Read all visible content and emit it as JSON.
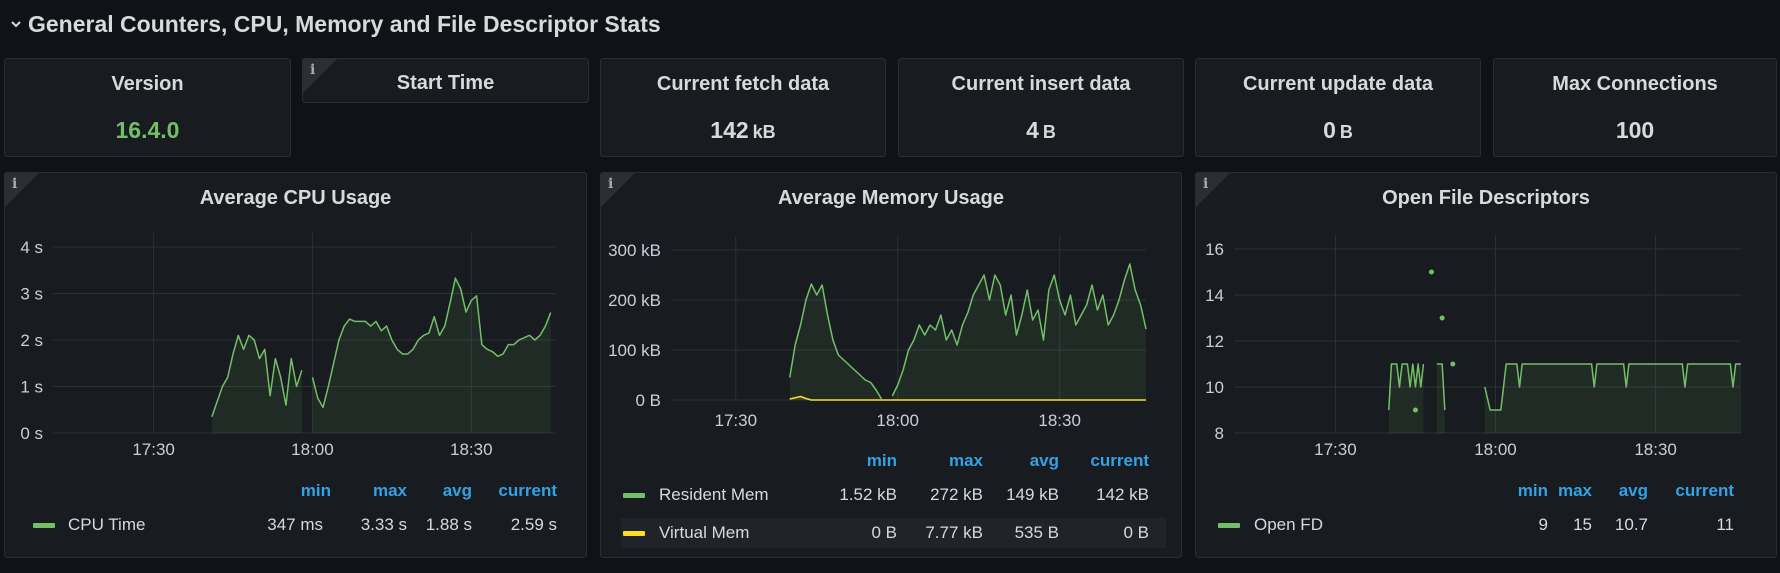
{
  "row": {
    "title": "General Counters, CPU, Memory and File Descriptor Stats"
  },
  "stats": [
    {
      "title": "Version",
      "value": "16.4.0",
      "unit": "",
      "info": false
    },
    {
      "title": "Start Time",
      "value": "",
      "unit": "",
      "info": true
    },
    {
      "title": "Current fetch data",
      "value": "142",
      "unit": "kB",
      "info": false
    },
    {
      "title": "Current insert data",
      "value": "4",
      "unit": "B",
      "info": false
    },
    {
      "title": "Current update data",
      "value": "0",
      "unit": "B",
      "info": false
    },
    {
      "title": "Max Connections",
      "value": "100",
      "unit": "",
      "info": false
    }
  ],
  "colors": {
    "green": "#73bf69",
    "yellow": "#fade2a",
    "blue": "#33a2e5"
  },
  "info_icon": "info-icon",
  "legend_headers": [
    "min",
    "max",
    "avg",
    "current"
  ],
  "graphs": [
    {
      "id": "cpu",
      "title": "Average CPU Usage",
      "legend": [
        {
          "name": "CPU Time",
          "color": "#73bf69",
          "min": "347 ms",
          "max": "3.33 s",
          "avg": "1.88 s",
          "current": "2.59 s"
        }
      ],
      "chart_data": {
        "type": "line",
        "title": "Average CPU Usage",
        "x_ticks": [
          "17:30",
          "18:00",
          "18:30"
        ],
        "y_ticks": [
          "0 s",
          "1 s",
          "2 s",
          "3 s",
          "4 s"
        ],
        "ylim": [
          0,
          4
        ],
        "grid": true,
        "series": [
          {
            "name": "CPU Time",
            "color": "#73bf69",
            "segments": [
              [
                [
                  "17:41",
                  0.35
                ],
                [
                  "17:43",
                  1.0
                ],
                [
                  "17:44",
                  1.2
                ],
                [
                  "17:45",
                  1.7
                ],
                [
                  "17:46",
                  2.1
                ],
                [
                  "17:47",
                  1.8
                ],
                [
                  "17:48",
                  2.1
                ],
                [
                  "17:49",
                  2.0
                ],
                [
                  "17:50",
                  1.6
                ],
                [
                  "17:51",
                  1.8
                ],
                [
                  "17:52",
                  0.8
                ],
                [
                  "17:53",
                  1.6
                ],
                [
                  "17:54",
                  1.2
                ],
                [
                  "17:55",
                  0.6
                ],
                [
                  "17:56",
                  1.6
                ],
                [
                  "17:57",
                  1.0
                ],
                [
                  "17:58",
                  1.35
                ]
              ],
              [
                [
                  "18:00",
                  1.2
                ],
                [
                  "18:01",
                  0.75
                ],
                [
                  "18:02",
                  0.55
                ],
                [
                  "18:03",
                  1.0
                ],
                [
                  "18:04",
                  1.5
                ],
                [
                  "18:05",
                  2.0
                ],
                [
                  "18:06",
                  2.3
                ],
                [
                  "18:07",
                  2.45
                ],
                [
                  "18:08",
                  2.4
                ],
                [
                  "18:10",
                  2.4
                ],
                [
                  "18:11",
                  2.3
                ],
                [
                  "18:12",
                  2.4
                ],
                [
                  "18:13",
                  2.2
                ],
                [
                  "18:14",
                  2.3
                ],
                [
                  "18:15",
                  2.0
                ],
                [
                  "18:16",
                  1.8
                ],
                [
                  "18:17",
                  1.7
                ],
                [
                  "18:18",
                  1.7
                ],
                [
                  "18:19",
                  1.8
                ],
                [
                  "18:20",
                  2.0
                ],
                [
                  "18:21",
                  2.1
                ],
                [
                  "18:22",
                  2.15
                ],
                [
                  "18:23",
                  2.5
                ],
                [
                  "18:24",
                  2.1
                ],
                [
                  "18:25",
                  2.3
                ],
                [
                  "18:26",
                  2.8
                ],
                [
                  "18:27",
                  3.33
                ],
                [
                  "18:28",
                  3.1
                ],
                [
                  "18:29",
                  2.6
                ],
                [
                  "18:30",
                  2.85
                ],
                [
                  "18:31",
                  2.95
                ],
                [
                  "18:32",
                  1.9
                ],
                [
                  "18:33",
                  1.8
                ],
                [
                  "18:34",
                  1.75
                ],
                [
                  "18:35",
                  1.65
                ],
                [
                  "18:36",
                  1.7
                ],
                [
                  "18:37",
                  1.9
                ],
                [
                  "18:38",
                  1.9
                ],
                [
                  "18:39",
                  2.0
                ],
                [
                  "18:40",
                  2.05
                ],
                [
                  "18:41",
                  2.1
                ],
                [
                  "18:42",
                  2.0
                ],
                [
                  "18:43",
                  2.1
                ],
                [
                  "18:44",
                  2.3
                ],
                [
                  "18:45",
                  2.59
                ]
              ]
            ]
          }
        ]
      }
    },
    {
      "id": "mem",
      "title": "Average Memory Usage",
      "legend": [
        {
          "name": "Resident Mem",
          "color": "#73bf69",
          "min": "1.52 kB",
          "max": "272 kB",
          "avg": "149 kB",
          "current": "142 kB"
        },
        {
          "name": "Virtual Mem",
          "color": "#fade2a",
          "min": "0 B",
          "max": "7.77 kB",
          "avg": "535 B",
          "current": "0 B"
        }
      ],
      "chart_data": {
        "type": "line",
        "title": "Average Memory Usage",
        "x_ticks": [
          "17:30",
          "18:00",
          "18:30"
        ],
        "y_ticks": [
          "0 B",
          "100 kB",
          "200 kB",
          "300 kB"
        ],
        "ylim": [
          0,
          300
        ],
        "grid": true,
        "series": [
          {
            "name": "Resident Mem",
            "color": "#73bf69",
            "segments": [
              [
                [
                  "17:40",
                  45
                ],
                [
                  "17:41",
                  110
                ],
                [
                  "17:42",
                  150
                ],
                [
                  "17:43",
                  200
                ],
                [
                  "17:44",
                  232
                ],
                [
                  "17:45",
                  210
                ],
                [
                  "17:46",
                  230
                ],
                [
                  "17:47",
                  170
                ],
                [
                  "17:48",
                  120
                ],
                [
                  "17:49",
                  90
                ],
                [
                  "17:50",
                  80
                ],
                [
                  "17:51",
                  70
                ],
                [
                  "17:52",
                  60
                ],
                [
                  "17:53",
                  50
                ],
                [
                  "17:54",
                  40
                ],
                [
                  "17:55",
                  35
                ],
                [
                  "17:56",
                  20
                ],
                [
                  "17:57",
                  2
                ]
              ],
              [
                [
                  "17:59",
                  8
                ],
                [
                  "18:00",
                  30
                ],
                [
                  "18:01",
                  60
                ],
                [
                  "18:02",
                  100
                ],
                [
                  "18:03",
                  120
                ],
                [
                  "18:04",
                  150
                ],
                [
                  "18:05",
                  130
                ],
                [
                  "18:06",
                  150
                ],
                [
                  "18:07",
                  140
                ],
                [
                  "18:08",
                  170
                ],
                [
                  "18:09",
                  120
                ],
                [
                  "18:10",
                  140
                ],
                [
                  "18:11",
                  110
                ],
                [
                  "18:12",
                  150
                ],
                [
                  "18:13",
                  175
                ],
                [
                  "18:14",
                  210
                ],
                [
                  "18:15",
                  230
                ],
                [
                  "18:16",
                  250
                ],
                [
                  "18:17",
                  200
                ],
                [
                  "18:18",
                  250
                ],
                [
                  "18:19",
                  230
                ],
                [
                  "18:20",
                  170
                ],
                [
                  "18:21",
                  210
                ],
                [
                  "18:22",
                  130
                ],
                [
                  "18:23",
                  170
                ],
                [
                  "18:24",
                  220
                ],
                [
                  "18:25",
                  160
                ],
                [
                  "18:26",
                  180
                ],
                [
                  "18:27",
                  120
                ],
                [
                  "18:28",
                  220
                ],
                [
                  "18:29",
                  250
                ],
                [
                  "18:30",
                  200
                ],
                [
                  "18:31",
                  170
                ],
                [
                  "18:32",
                  210
                ],
                [
                  "18:33",
                  150
                ],
                [
                  "18:34",
                  170
                ],
                [
                  "18:35",
                  190
                ],
                [
                  "18:36",
                  230
                ],
                [
                  "18:37",
                  180
                ],
                [
                  "18:38",
                  210
                ],
                [
                  "18:39",
                  150
                ],
                [
                  "18:40",
                  170
                ],
                [
                  "18:41",
                  200
                ],
                [
                  "18:42",
                  240
                ],
                [
                  "18:43",
                  272
                ],
                [
                  "18:44",
                  220
                ],
                [
                  "18:45",
                  190
                ],
                [
                  "18:46",
                  142
                ]
              ]
            ]
          },
          {
            "name": "Virtual Mem",
            "color": "#fade2a",
            "segments": [
              [
                [
                  "17:40",
                  2
                ],
                [
                  "17:42",
                  7
                ],
                [
                  "17:43",
                  3
                ],
                [
                  "17:44",
                  0
                ],
                [
                  "18:46",
                  0
                ]
              ]
            ]
          }
        ]
      }
    },
    {
      "id": "fd",
      "title": "Open File Descriptors",
      "legend": [
        {
          "name": "Open FD",
          "color": "#73bf69",
          "min": "9",
          "max": "15",
          "avg": "10.7",
          "current": "11"
        }
      ],
      "chart_data": {
        "type": "line",
        "title": "Open File Descriptors",
        "x_ticks": [
          "17:30",
          "18:00",
          "18:30"
        ],
        "y_ticks": [
          "8",
          "10",
          "12",
          "14",
          "16"
        ],
        "ylim": [
          8,
          16
        ],
        "grid": true,
        "series": [
          {
            "name": "Open FD",
            "color": "#73bf69",
            "segments": [
              [
                [
                  "17:40",
                  9
                ],
                [
                  "17:40.5",
                  11
                ],
                [
                  "17:41.5",
                  11
                ],
                [
                  "17:42",
                  10
                ],
                [
                  "17:42.5",
                  11
                ],
                [
                  "17:43.5",
                  11
                ],
                [
                  "17:44",
                  10
                ],
                [
                  "17:44.5",
                  11
                ],
                [
                  "17:45",
                  10
                ],
                [
                  "17:45.5",
                  11
                ],
                [
                  "17:46",
                  10
                ],
                [
                  "17:46.5",
                  11
                ]
              ],
              [
                [
                  "17:49",
                  11
                ],
                [
                  "17:50",
                  11
                ],
                [
                  "17:50.5",
                  9
                ]
              ],
              [
                [
                  "17:58",
                  10
                ],
                [
                  "17:59",
                  9
                ],
                [
                  "18:01",
                  9
                ],
                [
                  "18:01.5",
                  10
                ],
                [
                  "18:02",
                  11
                ],
                [
                  "18:04",
                  11
                ],
                [
                  "18:04.5",
                  10
                ],
                [
                  "18:05",
                  11
                ],
                [
                  "18:18",
                  11
                ],
                [
                  "18:18.5",
                  10
                ],
                [
                  "18:19",
                  11
                ],
                [
                  "18:24",
                  11
                ],
                [
                  "18:24.5",
                  10
                ],
                [
                  "18:25",
                  11
                ],
                [
                  "18:35",
                  11
                ],
                [
                  "18:35.5",
                  10
                ],
                [
                  "18:36",
                  11
                ],
                [
                  "18:44",
                  11
                ],
                [
                  "18:44.5",
                  10
                ],
                [
                  "18:45",
                  11
                ],
                [
                  "18:46",
                  11
                ]
              ]
            ],
            "points": [
              [
                "17:45",
                9
              ],
              [
                "17:48",
                15
              ],
              [
                "17:50",
                13
              ],
              [
                "17:52",
                11
              ]
            ]
          }
        ]
      }
    }
  ]
}
